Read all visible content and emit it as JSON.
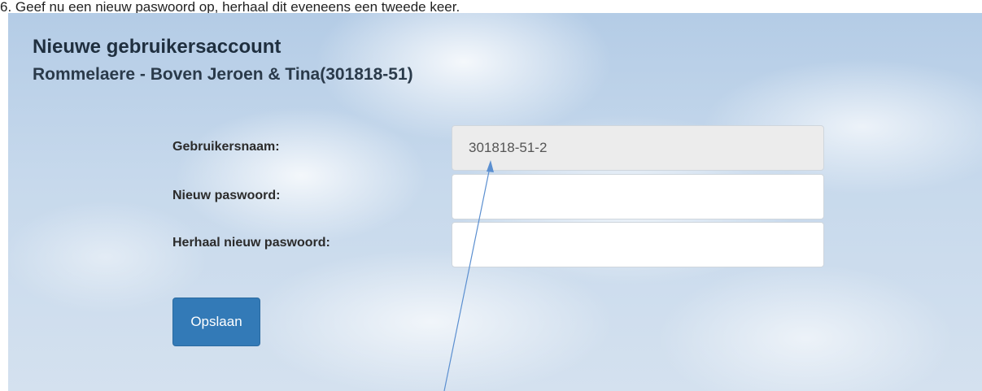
{
  "instruction": "6.   Geef nu een nieuw paswoord op, herhaal dit eveneens een tweede keer.",
  "page": {
    "title": "Nieuwe gebruikersaccount",
    "subtitle": "Rommelaere - Boven Jeroen & Tina(301818-51)"
  },
  "form": {
    "username_label": "Gebruikersnaam:",
    "username_value": "301818-51-2",
    "new_password_label": "Nieuw paswoord:",
    "new_password_value": "",
    "repeat_password_label": "Herhaal nieuw paswoord:",
    "repeat_password_value": "",
    "save_label": "Opslaan"
  },
  "colors": {
    "button": "#337ab7",
    "annotation_arrow": "#5b8fd0"
  }
}
